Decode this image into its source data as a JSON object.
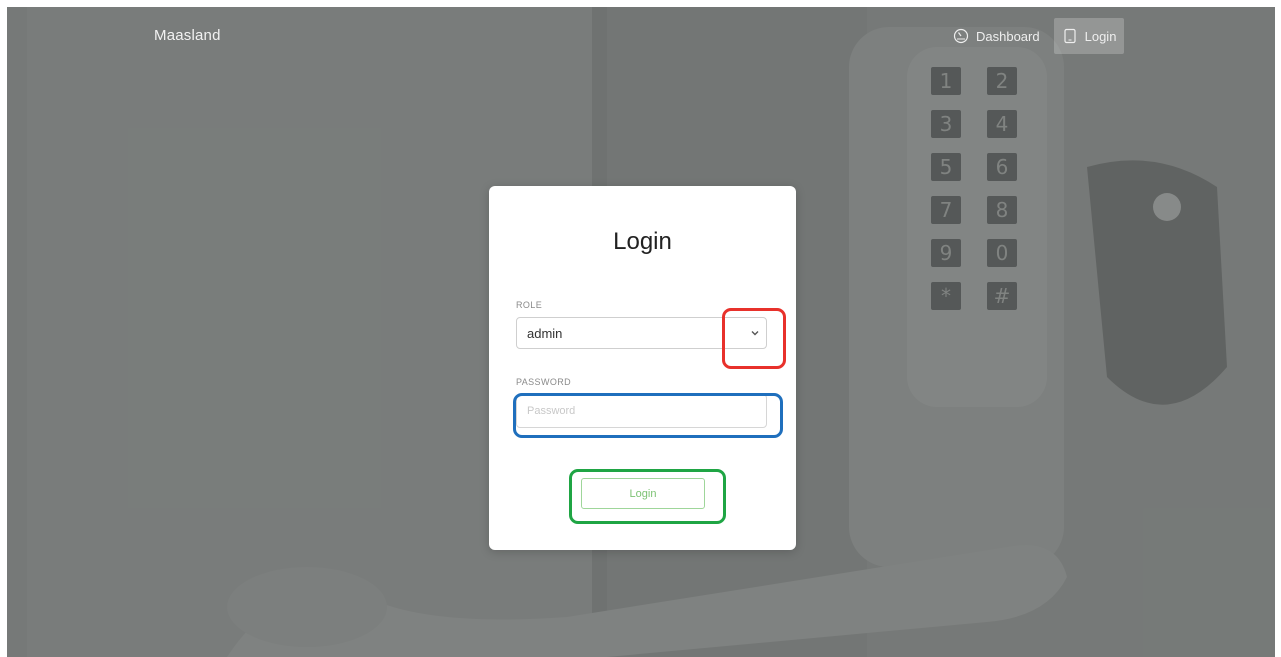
{
  "brand": {
    "name": "Maasland"
  },
  "nav": {
    "dashboard_label": "Dashboard",
    "login_label": "Login"
  },
  "login_card": {
    "title": "Login",
    "role_label": "ROLE",
    "role_value": "admin",
    "password_label": "PASSWORD",
    "password_placeholder": "Password",
    "submit_label": "Login"
  },
  "keypad": {
    "keys": [
      "1",
      "2",
      "3",
      "4",
      "5",
      "6",
      "7",
      "8",
      "9",
      "0",
      "*",
      "#"
    ]
  },
  "colors": {
    "highlight_select": "#e8312b",
    "highlight_password": "#1f6fbd",
    "highlight_button": "#1fa544",
    "button_text": "#7cc273"
  },
  "icons": {
    "dashboard": "dashboard-gauge-icon",
    "login": "tablet-icon",
    "select_arrow": "chevron-down-icon"
  }
}
